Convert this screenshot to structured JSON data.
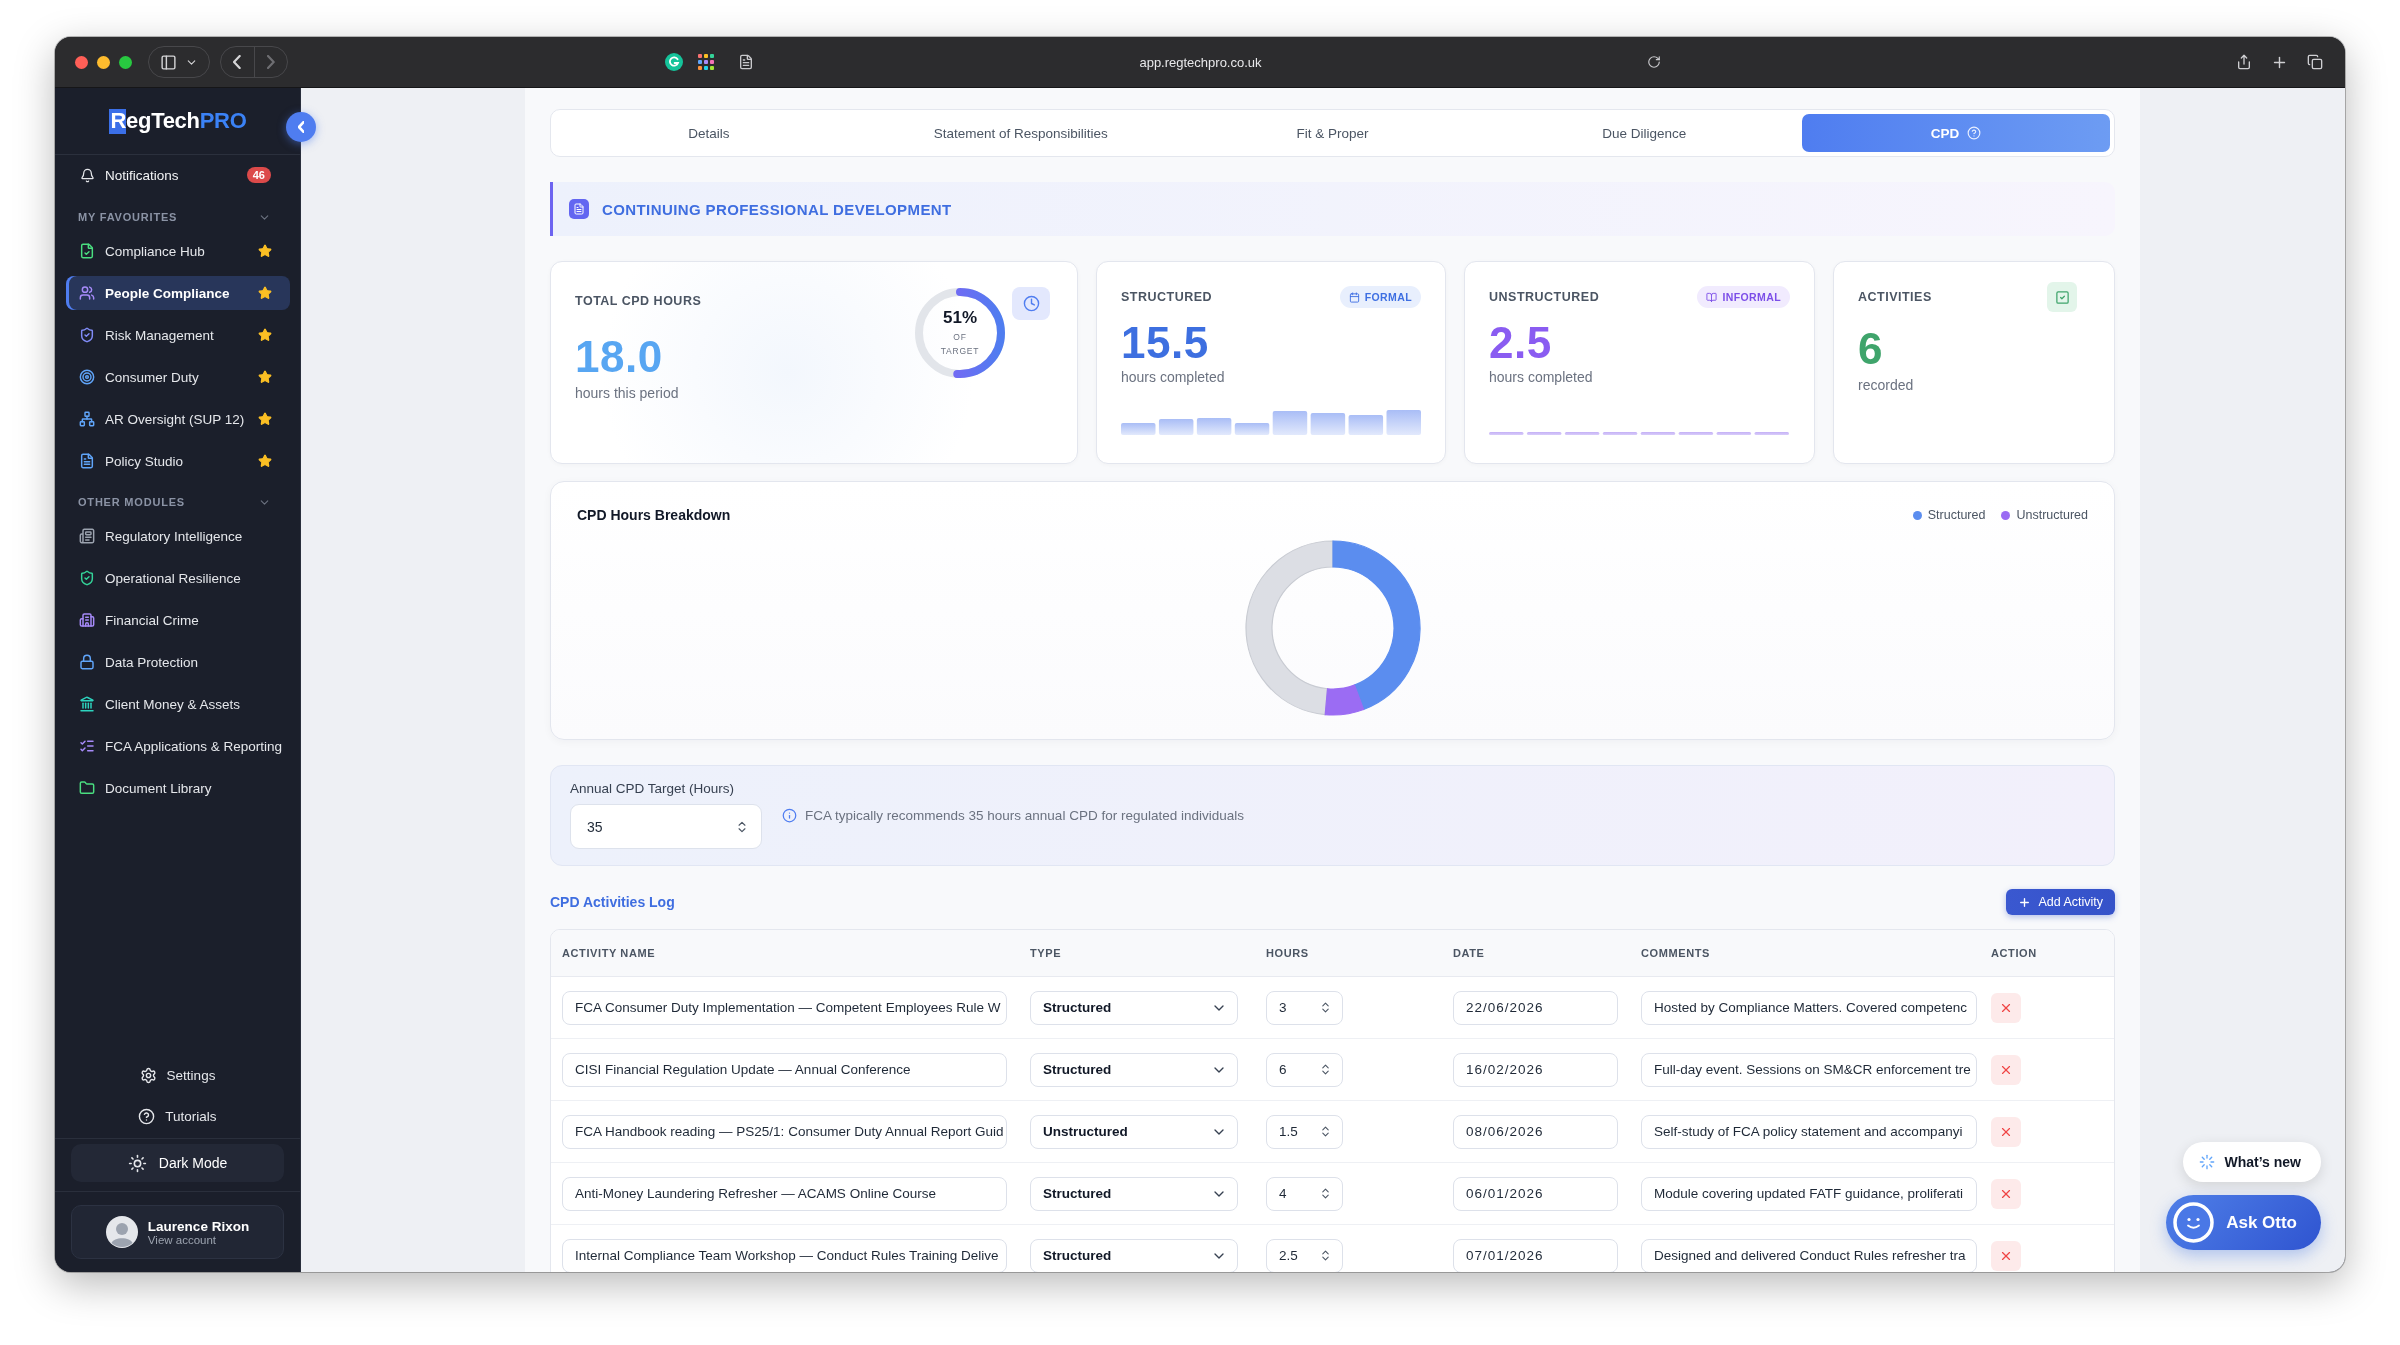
{
  "browser": {
    "url": "app.regtechpro.co.uk"
  },
  "sidebar": {
    "logo": {
      "mark": "R",
      "name": "egTech",
      "suffix": "PRO"
    },
    "notifications": {
      "label": "Notifications",
      "count": "46"
    },
    "sections": [
      {
        "kind": "favourites",
        "title": "MY FAVOURITES",
        "expanded": true,
        "items": [
          {
            "label": "Compliance Hub",
            "selected": false
          },
          {
            "label": "People Compliance",
            "selected": true
          },
          {
            "label": "Risk Management",
            "selected": false
          },
          {
            "label": "Consumer Duty",
            "selected": false
          },
          {
            "label": "AR Oversight (SUP 12)",
            "selected": false
          },
          {
            "label": "Policy Studio",
            "selected": false
          }
        ]
      },
      {
        "kind": "modules",
        "title": "OTHER MODULES",
        "expanded": true,
        "items": [
          {
            "label": "Regulatory Intelligence",
            "selected": false
          },
          {
            "label": "Operational Resilience",
            "selected": false
          },
          {
            "label": "Financial Crime",
            "selected": false
          },
          {
            "label": "Data Protection",
            "selected": false
          },
          {
            "label": "Client Money & Assets",
            "selected": false
          },
          {
            "label": "FCA Applications & Reporting",
            "selected": false
          },
          {
            "label": "Document Library",
            "selected": false
          }
        ]
      }
    ],
    "links": [
      "Settings",
      "Tutorials"
    ],
    "dark_mode": "Dark Mode",
    "user": {
      "name": "Laurence Rixon",
      "subtitle": "View account"
    }
  },
  "tabs": [
    {
      "label": "Details",
      "selected": false,
      "help_icon": false
    },
    {
      "label": "Statement of Responsibilities",
      "selected": false,
      "help_icon": false
    },
    {
      "label": "Fit & Proper",
      "selected": false,
      "help_icon": false
    },
    {
      "label": "Due Diligence",
      "selected": false,
      "help_icon": false
    },
    {
      "label": "CPD",
      "selected": true,
      "help_icon": true
    }
  ],
  "section_title": "CONTINUING PROFESSIONAL DEVELOPMENT",
  "stats": [
    {
      "kind": "total",
      "label": "TOTAL CPD HOURS",
      "value": "18.0",
      "caption": "hours this period",
      "progress": {
        "value": "51%",
        "caption": "OF TARGET",
        "level": 0.51
      }
    },
    {
      "kind": "structured",
      "label": "STRUCTURED",
      "badge": "FORMAL",
      "value": "15.5",
      "caption": "hours completed"
    },
    {
      "kind": "unstructured",
      "label": "UNSTRUCTURED",
      "badge": "INFORMAL",
      "value": "2.5",
      "caption": "hours completed"
    },
    {
      "kind": "activities",
      "label": "ACTIVITIES",
      "value": "6",
      "caption": "recorded"
    }
  ],
  "breakdown": {
    "title": "CPD Hours Breakdown",
    "legend": [
      {
        "label": "Structured",
        "color": "#5b8def"
      },
      {
        "label": "Unstructured",
        "color": "#9b6cf3"
      }
    ]
  },
  "target": {
    "label": "Annual CPD Target (Hours)",
    "value": "35",
    "note": "FCA typically recommends 35 hours annual CPD for regulated individuals"
  },
  "log": {
    "title": "CPD Activities Log",
    "add_button": "Add Activity",
    "columns": [
      "ACTIVITY NAME",
      "TYPE",
      "HOURS",
      "DATE",
      "COMMENTS",
      "ACTION"
    ],
    "rows": [
      {
        "name": "FCA Consumer Duty Implementation — Competent Employees Rule W",
        "type": "Structured",
        "hours": "3",
        "date": "22/06/2026",
        "comments": "Hosted by Compliance Matters. Covered competenc"
      },
      {
        "name": "CISI Financial Regulation Update — Annual Conference",
        "type": "Structured",
        "hours": "6",
        "date": "16/02/2026",
        "comments": "Full-day event. Sessions on SM&CR enforcement tre"
      },
      {
        "name": "FCA Handbook reading — PS25/1: Consumer Duty Annual Report Guid",
        "type": "Unstructured",
        "hours": "1.5",
        "date": "08/06/2026",
        "comments": "Self-study of FCA policy statement and accompanyi"
      },
      {
        "name": "Anti-Money Laundering Refresher — ACAMS Online Course",
        "type": "Structured",
        "hours": "4",
        "date": "06/01/2026",
        "comments": "Module covering updated FATF guidance, proliferati"
      },
      {
        "name": "Internal Compliance Team Workshop — Conduct Rules Training Delive",
        "type": "Structured",
        "hours": "2.5",
        "date": "07/01/2026",
        "comments": "Designed and delivered Conduct Rules refresher tra"
      }
    ]
  },
  "assistant": {
    "whats_new": "What’s new",
    "ask": "Ask Otto"
  }
}
